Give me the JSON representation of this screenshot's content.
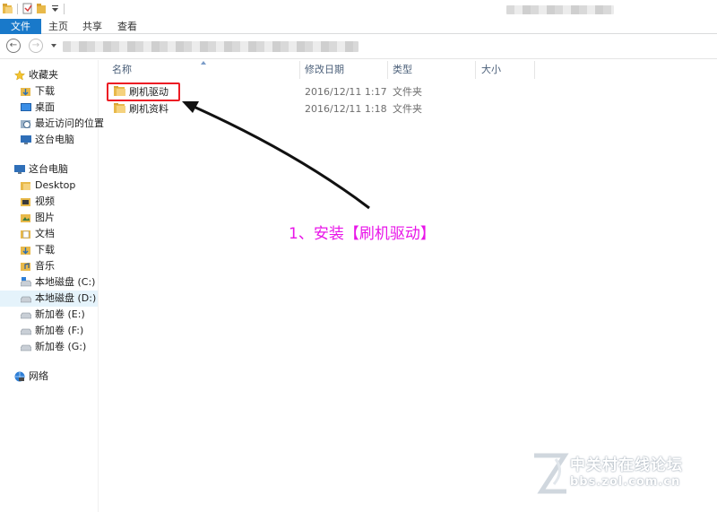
{
  "ribbon": {
    "tabs": [
      "文件",
      "主页",
      "共享",
      "查看"
    ]
  },
  "navigation": {
    "favorites_header": "收藏夹",
    "favorites": [
      "下载",
      "桌面",
      "最近访问的位置",
      "这台电脑"
    ],
    "this_pc_header": "这台电脑",
    "this_pc_items": [
      "Desktop",
      "视频",
      "图片",
      "文档",
      "下载",
      "音乐",
      "本地磁盘 (C:)",
      "本地磁盘 (D:)",
      "新加卷 (E:)",
      "新加卷 (F:)",
      "新加卷 (G:)"
    ],
    "network": "网络",
    "selected_item": "本地磁盘 (D:)"
  },
  "columns": {
    "name": "名称",
    "date": "修改日期",
    "type": "类型",
    "size": "大小"
  },
  "files": [
    {
      "name": "刷机驱动",
      "date": "2016/12/11 1:17",
      "type": "文件夹"
    },
    {
      "name": "刷机资料",
      "date": "2016/12/11 1:18",
      "type": "文件夹"
    }
  ],
  "annotation": "1、安装【刷机驱动】",
  "watermark": {
    "brand": "中关村在线论坛",
    "url": "bbs.zol.com.cn"
  },
  "colors": {
    "file_tab": "#1979ca",
    "highlight_box": "#ec1c24",
    "annotation_text": "#e815e8",
    "selected_nav": "#e5f3fb",
    "folder": "#e8b94a"
  }
}
